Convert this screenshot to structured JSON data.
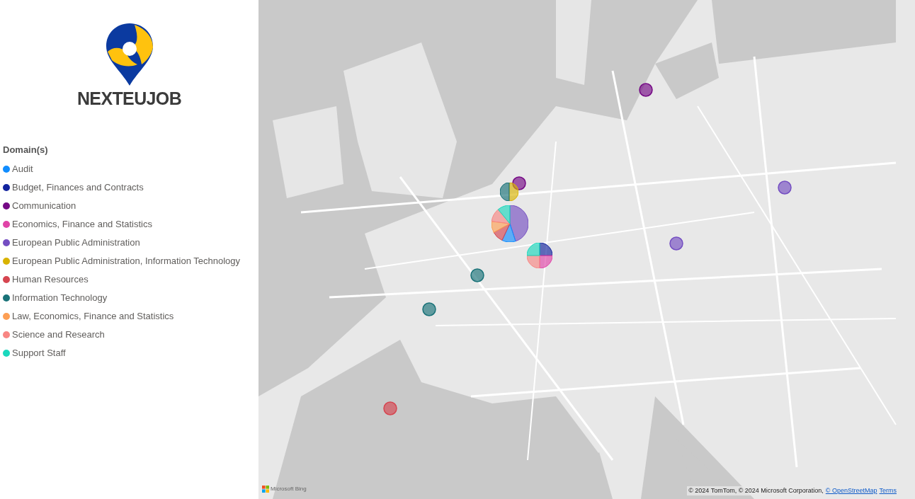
{
  "logo": {
    "text": "NEXTEUJOB"
  },
  "legend": {
    "title": "Domain(s)",
    "items": [
      {
        "label": "Audit",
        "color": "#118dff"
      },
      {
        "label": "Budget, Finances and Contracts",
        "color": "#12239e"
      },
      {
        "label": "Communication",
        "color": "#750985"
      },
      {
        "label": "Economics, Finance and Statistics",
        "color": "#e044a7"
      },
      {
        "label": "European Public Administration",
        "color": "#744ec2"
      },
      {
        "label": "European Public Administration, Information Technology",
        "color": "#d9b300"
      },
      {
        "label": "Human Resources",
        "color": "#d64550"
      },
      {
        "label": "Information Technology",
        "color": "#197278"
      },
      {
        "label": "Law, Economics, Finance and Statistics",
        "color": "#fd9f54"
      },
      {
        "label": "Science and Research",
        "color": "#f88683"
      },
      {
        "label": "Support Staff",
        "color": "#1ad8bd"
      }
    ]
  },
  "map": {
    "provider": "Microsoft Bing",
    "attribution": "© 2024 TomTom, © 2024 Microsoft Corporation,",
    "osm_link": "© OpenStreetMap",
    "terms_link": "Terms"
  }
}
